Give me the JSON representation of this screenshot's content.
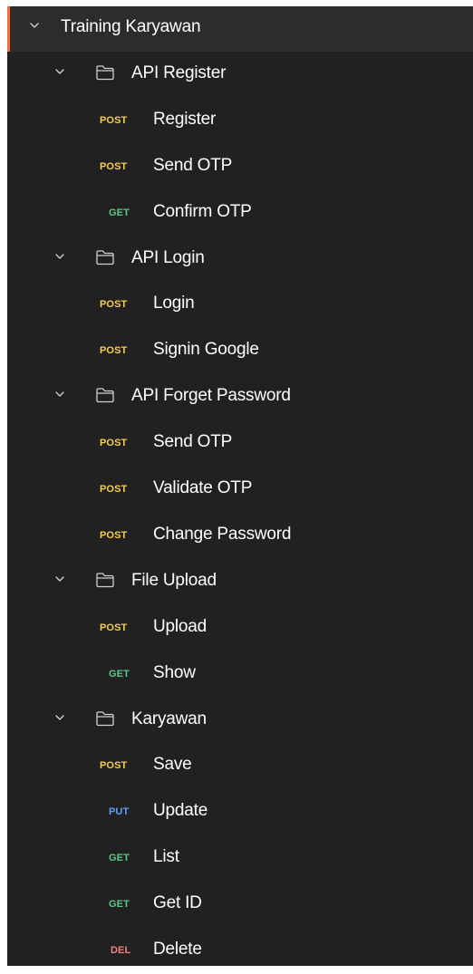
{
  "collection": {
    "name": "Training Karyawan",
    "expanded": true
  },
  "folders": [
    {
      "name": "API Register",
      "expanded": true,
      "requests": [
        {
          "method": "POST",
          "name": "Register"
        },
        {
          "method": "POST",
          "name": "Send OTP"
        },
        {
          "method": "GET",
          "name": "Confirm OTP"
        }
      ]
    },
    {
      "name": "API Login",
      "expanded": true,
      "requests": [
        {
          "method": "POST",
          "name": "Login"
        },
        {
          "method": "POST",
          "name": "Signin Google"
        }
      ]
    },
    {
      "name": "API Forget Password",
      "expanded": true,
      "requests": [
        {
          "method": "POST",
          "name": "Send OTP"
        },
        {
          "method": "POST",
          "name": "Validate OTP"
        },
        {
          "method": "POST",
          "name": "Change Password"
        }
      ]
    },
    {
      "name": "File Upload",
      "expanded": true,
      "requests": [
        {
          "method": "POST",
          "name": "Upload"
        },
        {
          "method": "GET",
          "name": "Show"
        }
      ]
    },
    {
      "name": "Karyawan",
      "expanded": true,
      "requests": [
        {
          "method": "POST",
          "name": "Save"
        },
        {
          "method": "PUT",
          "name": "Update"
        },
        {
          "method": "GET",
          "name": "List"
        },
        {
          "method": "GET",
          "name": "Get ID"
        },
        {
          "method": "DEL",
          "name": "Delete"
        }
      ]
    }
  ],
  "method_colors": {
    "POST": "#f5cd4f",
    "GET": "#58c989",
    "PUT": "#5c9ffa",
    "DEL": "#f37e7e"
  },
  "colors": {
    "panel_background": "#212121",
    "collection_background": "#2c2c2c",
    "accent": "#ff6c37",
    "text": "#ffffff"
  },
  "icons": {
    "expand": "chevron-down-icon",
    "folder": "folder-icon"
  }
}
